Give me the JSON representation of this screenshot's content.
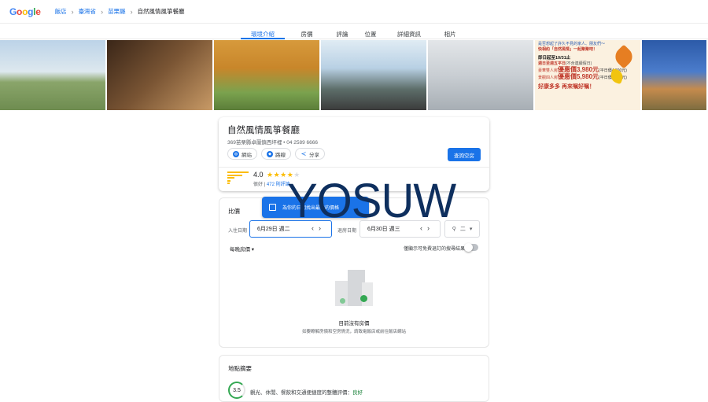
{
  "logo": "Google",
  "logo_colors": [
    "#4285F4",
    "#EA4335",
    "#FBBC05",
    "#4285F4",
    "#34A853",
    "#EA4335"
  ],
  "breadcrumb": {
    "items": [
      "飯店",
      "臺灣省",
      "苗栗縣",
      "自然風情風箏餐廳"
    ]
  },
  "tabs": [
    "環境介紹",
    "房價",
    "評論",
    "位置",
    "詳細資訊",
    "相片"
  ],
  "promo": {
    "line1": "是否想起了許久不見的家人、朋友們～",
    "line2": "快相約「自然風情」一起聚聚吧！",
    "line3": "即日起至10/31止",
    "line4": "週日至週五平日",
    "line4_note": "(不含連續假日)",
    "line5_label": "豪華雙人房",
    "line5_price": "優惠價3,980元",
    "line5_note": "(平日價4,800元)",
    "line6_label": "景觀四人房",
    "line6_price": "優惠價5,980元",
    "line6_note": "(平日價6,800元)",
    "line7": "好康多多 再來嘱好嘱！"
  },
  "hotel": {
    "name": "自然風情風箏餐廳",
    "address": "369苗栗縣卓蘭鎮西坪裡 • 04 2589 6666",
    "chips": {
      "website": "網站",
      "directions": "路線",
      "share": "分享"
    },
    "book_button": "查詢空房",
    "rating": "4.0",
    "stars_filled": 4,
    "rating_label": "很好",
    "reviews_label": "472 則評論"
  },
  "price": {
    "title": "比價",
    "toast": "為你的日期找出最佳的價格",
    "checkin_label": "入住日期",
    "checkin_value": "6月29日 週二",
    "checkout_label": "退房日期",
    "checkout_value": "6月30日 週三",
    "guests_value": "二",
    "sort_label": "每晚房價",
    "toggle_label": "僅顯示可免費退訂的搜尋結果",
    "empty_title": "目前沒有房價",
    "empty_subtitle": "如要瞭解房價和空房情況，請致電飯店或前往飯店網站"
  },
  "location": {
    "title": "地點摘要",
    "score": "3.5",
    "text": "觀光、休閒、餐飲和交通便捷度的整體評價：",
    "grade": "良好"
  },
  "watermark": "YOSUW"
}
